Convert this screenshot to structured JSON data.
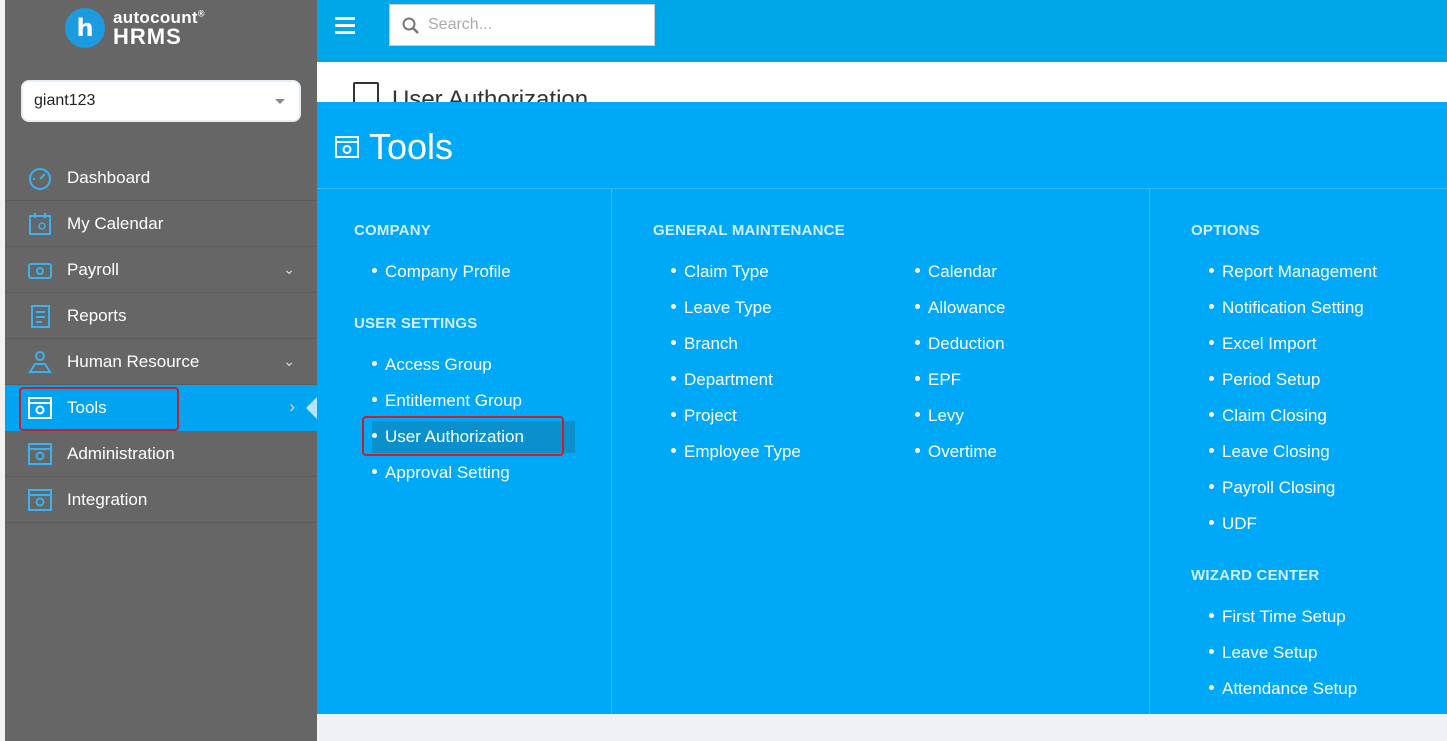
{
  "app": {
    "logo_top": "autocount",
    "logo_reg": "®",
    "logo_bottom": "HRMS",
    "logo_letter": "h"
  },
  "company_select": {
    "value": "giant123"
  },
  "search": {
    "placeholder": "Search..."
  },
  "page": {
    "title": "User Authorization"
  },
  "sidebar": {
    "items": [
      {
        "label": "Dashboard",
        "icon": "dashboard-icon",
        "has_chevron": false
      },
      {
        "label": "My Calendar",
        "icon": "calendar-icon",
        "has_chevron": false
      },
      {
        "label": "Payroll",
        "icon": "payroll-icon",
        "has_chevron": true
      },
      {
        "label": "Reports",
        "icon": "reports-icon",
        "has_chevron": false
      },
      {
        "label": "Human Resource",
        "icon": "human-resource-icon",
        "has_chevron": true
      },
      {
        "label": "Tools",
        "icon": "tools-icon",
        "has_chevron": true,
        "active": true
      },
      {
        "label": "Administration",
        "icon": "administration-icon",
        "has_chevron": false
      },
      {
        "label": "Integration",
        "icon": "integration-icon",
        "has_chevron": false
      }
    ]
  },
  "mega_menu": {
    "title": "Tools",
    "company": {
      "heading": "COMPANY",
      "items": [
        "Company Profile"
      ]
    },
    "user_settings": {
      "heading": "USER SETTINGS",
      "items": [
        "Access Group",
        "Entitlement Group",
        "User Authorization",
        "Approval Setting"
      ]
    },
    "general_maintenance": {
      "heading": "GENERAL MAINTENANCE",
      "col1": [
        "Claim Type",
        "Leave Type",
        "Branch",
        "Department",
        "Project",
        "Employee Type"
      ],
      "col2": [
        "Calendar",
        "Allowance",
        "Deduction",
        "EPF",
        "Levy",
        "Overtime"
      ]
    },
    "options": {
      "heading": "OPTIONS",
      "items": [
        "Report Management",
        "Notification Setting",
        "Excel Import",
        "Period Setup",
        "Claim Closing",
        "Leave Closing",
        "Payroll Closing",
        "UDF"
      ]
    },
    "wizard_center": {
      "heading": "WIZARD CENTER",
      "items": [
        "First Time Setup",
        "Leave Setup",
        "Attendance Setup"
      ]
    }
  },
  "colors": {
    "sidebar_bg": "#666666",
    "accent": "#00a8f8",
    "topbar": "#00a7e8",
    "highlight_border": "#c8202a"
  }
}
